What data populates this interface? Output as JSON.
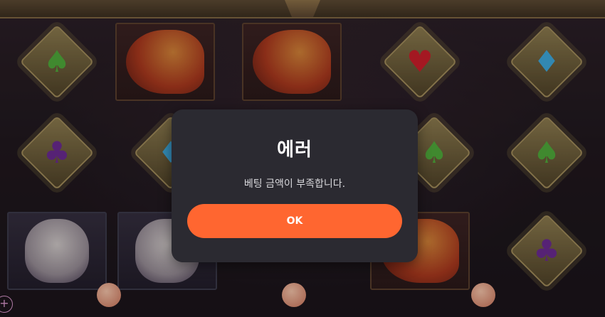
{
  "dialog": {
    "title": "에러",
    "message": "베팅 금액이 부족합니다.",
    "ok_label": "OK",
    "accent_color": "#ff6630",
    "background_color": "#2b2a31"
  },
  "background": {
    "symbols": [
      "green-spade-icon",
      "phoenix-symbol",
      "phoenix-symbol",
      "red-heart-icon",
      "blue-diamond-icon",
      "purple-club-icon",
      "blue-diamond-icon",
      "green-spade-icon",
      "green-spade-icon",
      "rabbit-symbol",
      "rabbit-symbol",
      "phoenix-symbol",
      "purple-club-icon"
    ],
    "corner_button_icon": "plus-icon"
  }
}
